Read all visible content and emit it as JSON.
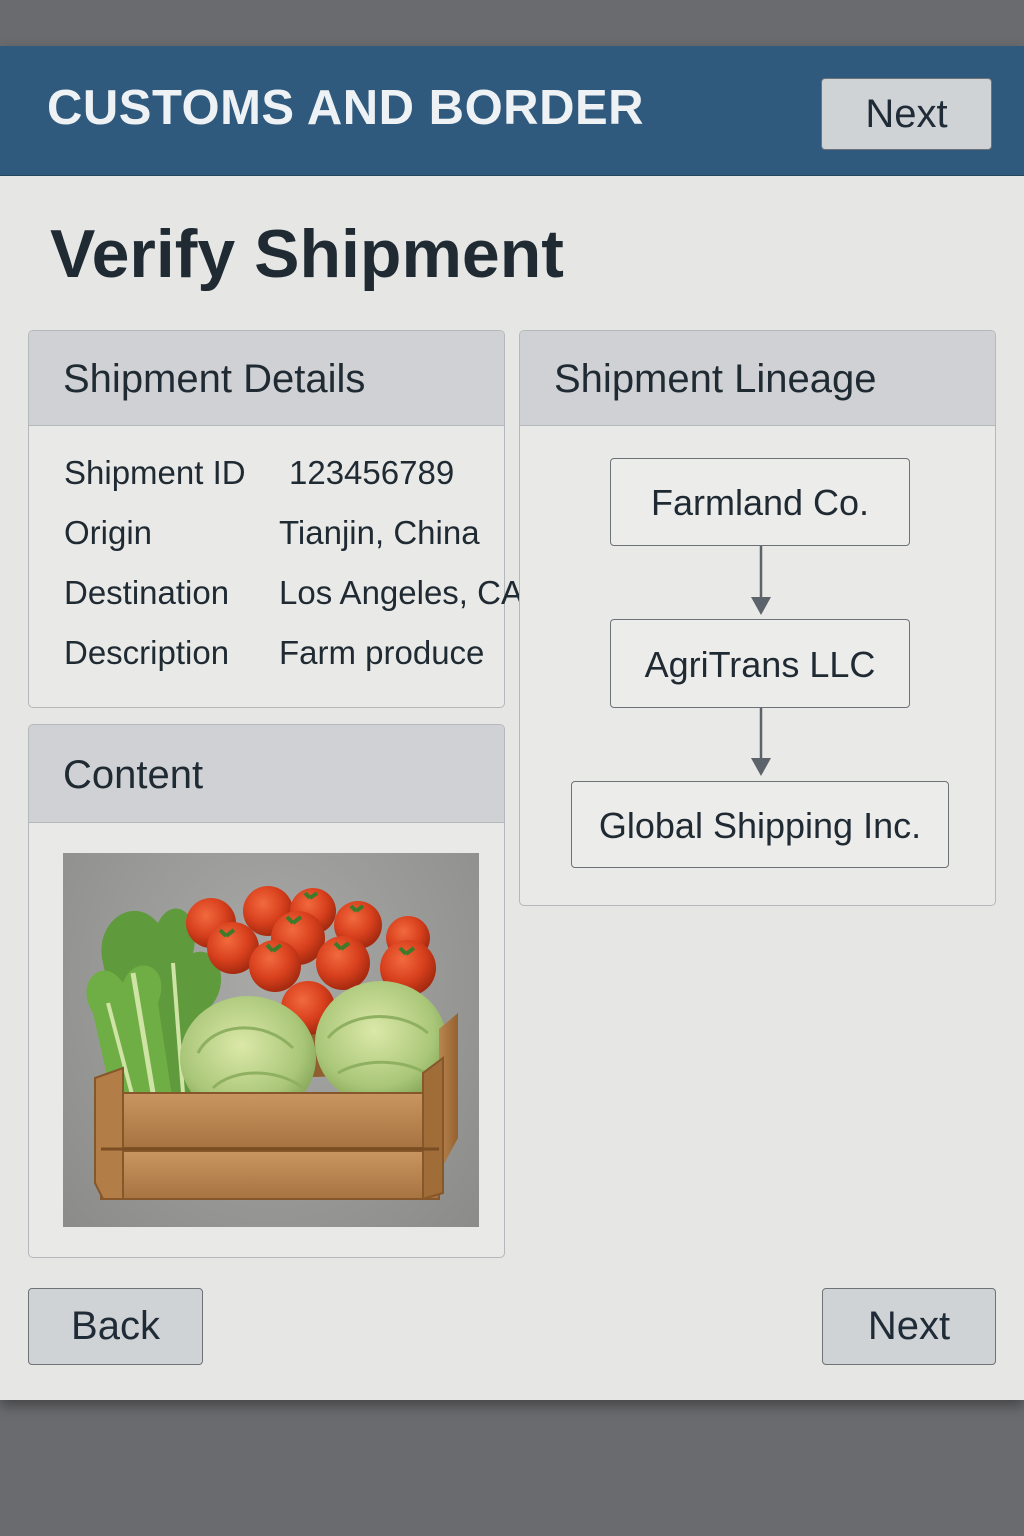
{
  "header": {
    "app_title": "CUSTOMS AND BORDER",
    "next_label": "Next"
  },
  "page": {
    "title": "Verify Shipment"
  },
  "details": {
    "heading": "Shipment Details",
    "rows": [
      {
        "label": "Shipment ID",
        "value": "123456789"
      },
      {
        "label": "Origin",
        "value": "Tianjin, China"
      },
      {
        "label": "Destination",
        "value": "Los Angeles, CA"
      },
      {
        "label": "Description",
        "value": "Farm produce"
      }
    ]
  },
  "lineage": {
    "heading": "Shipment Lineage",
    "nodes": [
      "Farmland Co.",
      "AgriTrans LLC",
      "Global Shipping Inc."
    ]
  },
  "content": {
    "heading": "Content"
  },
  "footer": {
    "back_label": "Back",
    "next_label": "Next"
  }
}
